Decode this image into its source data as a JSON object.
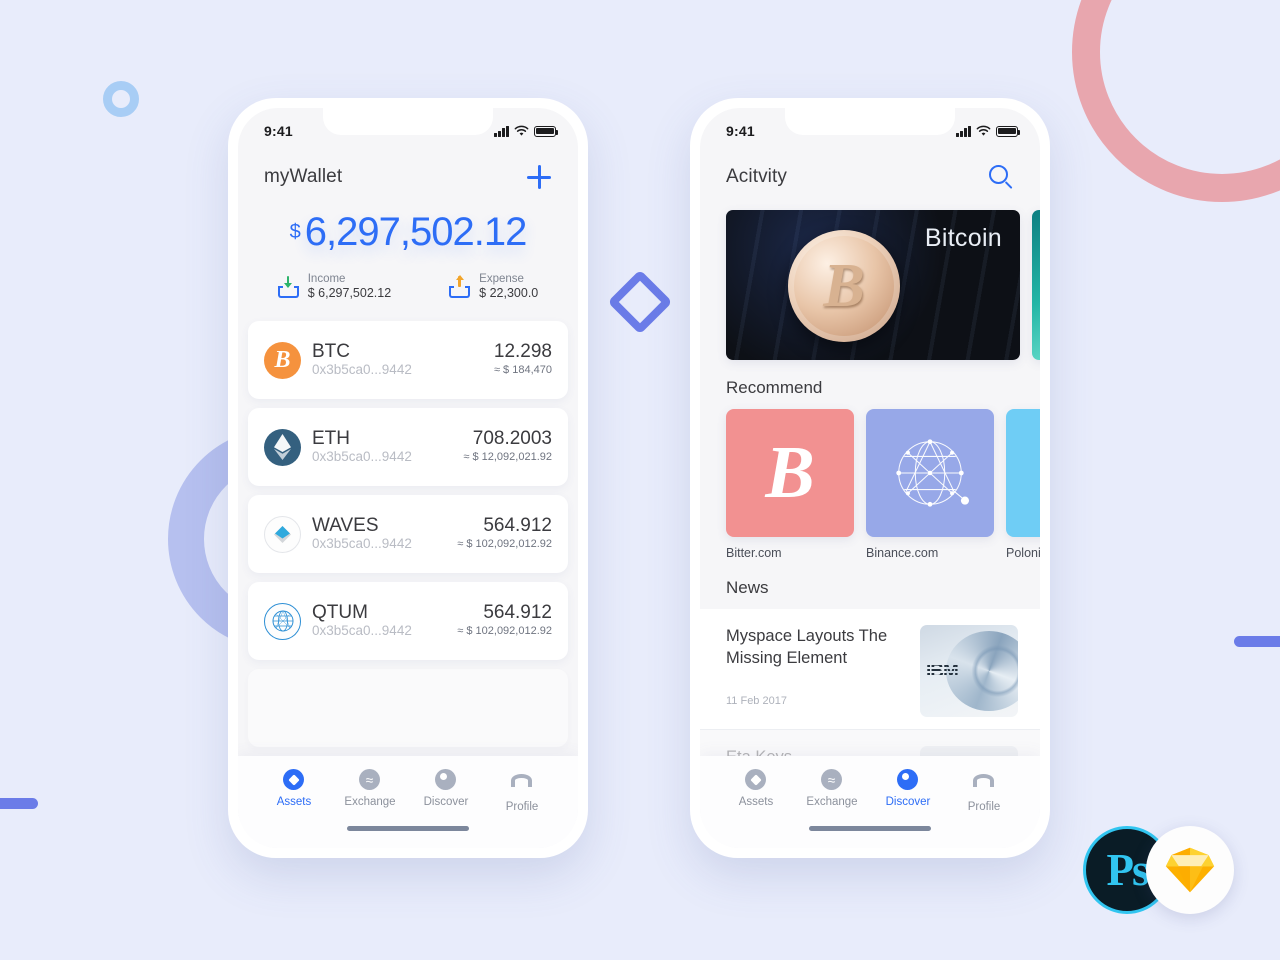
{
  "wallet_screen": {
    "status_bar": {
      "time": "9:41"
    },
    "header": {
      "title": "myWallet",
      "add_icon": "plus-icon"
    },
    "balance": {
      "currency_symbol": "$",
      "amount": "6,297,502.12",
      "income_label": "Income",
      "income_value": "$ 6,297,502.12",
      "expense_label": "Expense",
      "expense_value": "$ 22,300.0"
    },
    "assets": [
      {
        "symbol": "BTC",
        "address": "0x3b5ca0...9442",
        "amount": "12.298",
        "fiat": "≈ $ 184,470",
        "icon": "bitcoin-icon"
      },
      {
        "symbol": "ETH",
        "address": "0x3b5ca0...9442",
        "amount": "708.2003",
        "fiat": "≈ $ 12,092,021.92",
        "icon": "ethereum-icon"
      },
      {
        "symbol": "WAVES",
        "address": "0x3b5ca0...9442",
        "amount": "564.912",
        "fiat": "≈ $ 102,092,012.92",
        "icon": "waves-icon"
      },
      {
        "symbol": "QTUM",
        "address": "0x3b5ca0...9442",
        "amount": "564.912",
        "fiat": "≈ $ 102,092,012.92",
        "icon": "qtum-icon"
      }
    ],
    "tabs": [
      {
        "label": "Assets",
        "icon": "assets-icon",
        "active": true
      },
      {
        "label": "Exchange",
        "icon": "exchange-icon",
        "active": false
      },
      {
        "label": "Discover",
        "icon": "discover-icon",
        "active": false
      },
      {
        "label": "Profile",
        "icon": "profile-icon",
        "active": false
      }
    ]
  },
  "activity_screen": {
    "status_bar": {
      "time": "9:41"
    },
    "header": {
      "title": "Acitvity",
      "search_icon": "search-icon"
    },
    "banners": [
      {
        "caption": "Bitcoin"
      },
      {
        "caption": ""
      }
    ],
    "recommend": {
      "title": "Recommend",
      "items": [
        {
          "label": "Bitter.com",
          "color": "#f29191",
          "icon": "bitcoin-icon"
        },
        {
          "label": "Binance.com",
          "color": "#97a8e8",
          "icon": "binance-network-icon"
        },
        {
          "label": "Polonie",
          "color": "#6fcdf5",
          "icon": "poloniex-icon"
        }
      ]
    },
    "news": {
      "title": "News",
      "items": [
        {
          "title": "Myspace Layouts The Missing Element",
          "date": "11 Feb 2017",
          "thumb": "ibm-spiral-thumb"
        },
        {
          "title": "Eta Keys",
          "date": "",
          "thumb": "avatar-thumb"
        }
      ]
    },
    "tabs": [
      {
        "label": "Assets",
        "icon": "assets-icon",
        "active": false
      },
      {
        "label": "Exchange",
        "icon": "exchange-icon",
        "active": false
      },
      {
        "label": "Discover",
        "icon": "discover-icon",
        "active": true
      },
      {
        "label": "Profile",
        "icon": "profile-icon",
        "active": false
      }
    ]
  },
  "badges": {
    "photoshop": "Ps",
    "sketch": "sketch-diamond-icon"
  },
  "colors": {
    "background": "#e8ecfb",
    "accent_blue": "#2d6df6",
    "periwinkle": "#6b7ce8",
    "pink_ring": "#e8a6ae",
    "purple_ring": "#b6c0ef",
    "light_blue_circle": "#a8cdf5"
  }
}
